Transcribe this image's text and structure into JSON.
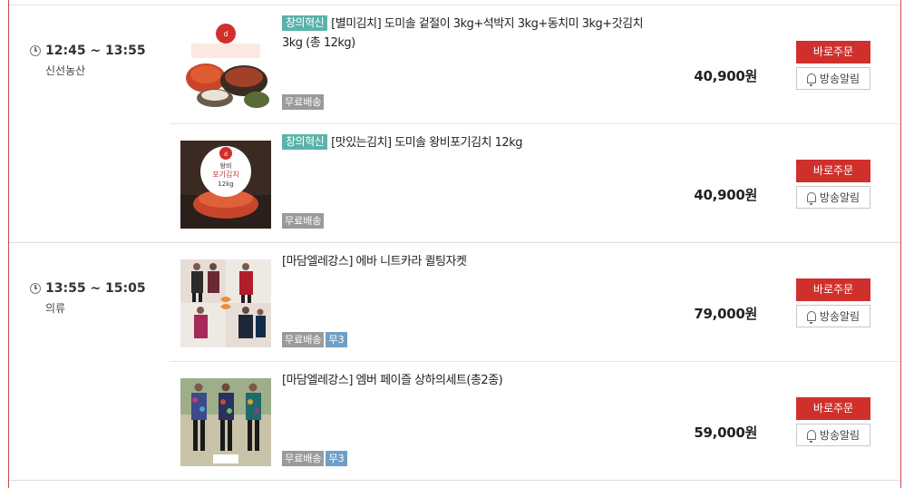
{
  "groups": [
    {
      "time": "12:45 ~ 13:55",
      "category": "신선농산",
      "items": [
        {
          "badge": "창의혁신",
          "title": "[별미김치] 도미솔 겉절이 3kg+석박지 3kg+동치미 3kg+갓김치 3kg (총 12kg)",
          "tags": [
            "무료배송"
          ],
          "price": "40,900원",
          "order_label": "바로주문",
          "alarm_label": "방송알림",
          "image": "kimchi-assortment"
        },
        {
          "badge": "창의혁신",
          "title": "[맛있는김치] 도미솔 왕비포기김치 12kg",
          "tags": [
            "무료배송"
          ],
          "price": "40,900원",
          "order_label": "바로주문",
          "alarm_label": "방송알림",
          "image": "kimchi-package",
          "pkg_line1": "왕비",
          "pkg_line2": "포기김치",
          "pkg_line3": "12kg"
        }
      ]
    },
    {
      "time": "13:55 ~ 15:05",
      "category": "의류",
      "items": [
        {
          "badge": "",
          "title": "[마담엘레강스] 에바 니트카라 퀼팅자켓",
          "tags": [
            "무료배송",
            "무3"
          ],
          "price": "79,000원",
          "order_label": "바로주문",
          "alarm_label": "방송알림",
          "image": "quilted-jackets"
        },
        {
          "badge": "",
          "title": "[마담엘레강스] 엠버 페이즐 상하의세트(총2종)",
          "tags": [
            "무료배송",
            "무3"
          ],
          "price": "59,000원",
          "order_label": "바로주문",
          "alarm_label": "방송알림",
          "image": "paisley-sets"
        }
      ]
    }
  ],
  "colors": {
    "accent_red": "#d0302c",
    "badge_teal": "#5bb2a9",
    "tag_gray": "#9a9a9a",
    "tag_blue": "#6f9fc6"
  }
}
